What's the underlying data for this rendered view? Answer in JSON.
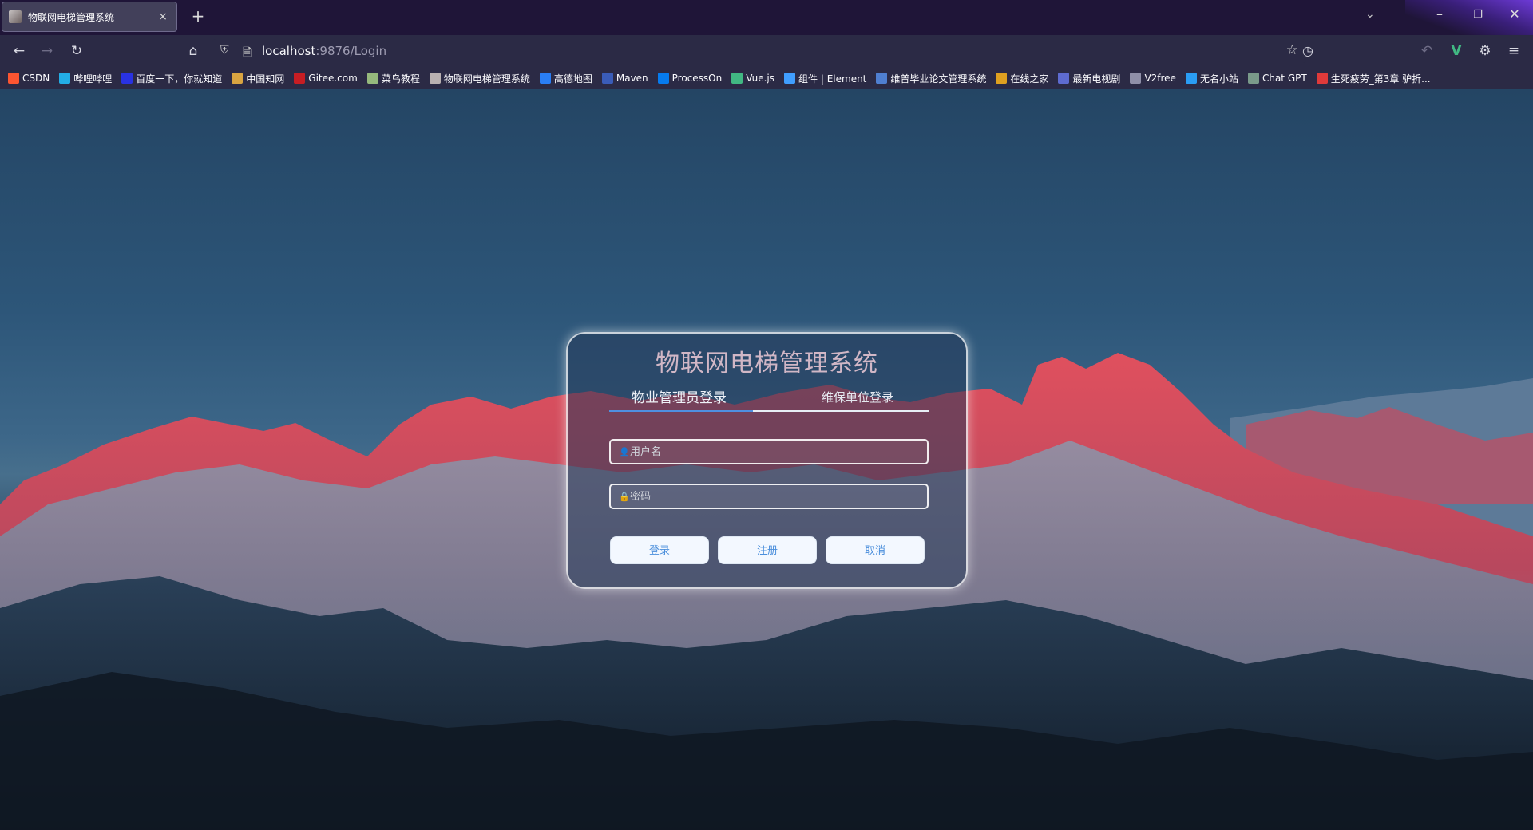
{
  "browser": {
    "tab_title": "物联网电梯管理系统",
    "tab_close": "×",
    "new_tab": "+",
    "url_host": "localhost",
    "url_rest": ":9876/Login",
    "bookmarks": [
      {
        "label": "CSDN",
        "color": "#fc5531"
      },
      {
        "label": "哔哩哔哩",
        "color": "#23ade5"
      },
      {
        "label": "百度一下，你就知道",
        "color": "#2932e1"
      },
      {
        "label": "中国知网",
        "color": "#d9a441"
      },
      {
        "label": "Gitee.com",
        "color": "#c71d23"
      },
      {
        "label": "菜鸟教程",
        "color": "#96b97d"
      },
      {
        "label": "物联网电梯管理系统",
        "color": "#b9b1b1"
      },
      {
        "label": "高德地图",
        "color": "#2a7ef5"
      },
      {
        "label": "Maven",
        "color": "#3a5cb8"
      },
      {
        "label": "ProcessOn",
        "color": "#067bef"
      },
      {
        "label": "Vue.js",
        "color": "#41b883"
      },
      {
        "label": "组件 | Element",
        "color": "#409eff"
      },
      {
        "label": "维普毕业论文管理系统",
        "color": "#4f7fd1"
      },
      {
        "label": "在线之家",
        "color": "#e0a020"
      },
      {
        "label": "最新电视剧",
        "color": "#5e6bd0"
      },
      {
        "label": "V2free",
        "color": "#8f8fa8"
      },
      {
        "label": "无名小站",
        "color": "#2a9df4"
      },
      {
        "label": "Chat GPT",
        "color": "#7a9a8a"
      },
      {
        "label": "生死疲劳_第3章 驴折...",
        "color": "#e03a3a"
      }
    ]
  },
  "login": {
    "title": "物联网电梯管理系统",
    "tab_admin": "物业管理员登录",
    "tab_maintenance": "维保单位登录",
    "username_placeholder": "用户名",
    "password_placeholder": "密码",
    "login_button": "登录",
    "register_button": "注册",
    "cancel_button": "取消"
  }
}
